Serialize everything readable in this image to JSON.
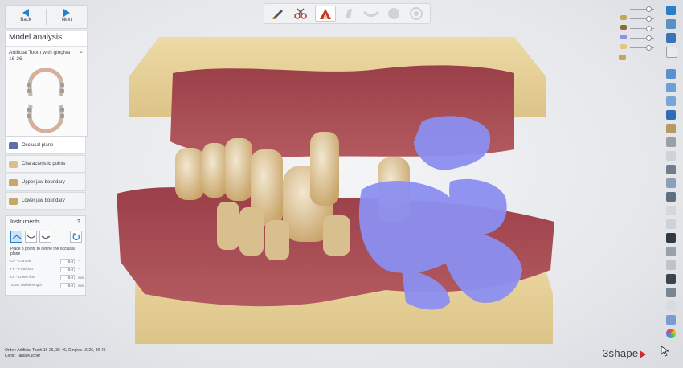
{
  "nav": {
    "back_label": "Back",
    "next_label": "Next"
  },
  "model": {
    "title": "Model analysis",
    "tooth_type": "Artificial Tooth with gingiva",
    "tooth_range": "16-26"
  },
  "steps": [
    {
      "label": "Occlusal plane",
      "active": true
    },
    {
      "label": "Characteristic points",
      "active": false
    },
    {
      "label": "Upper jaw boundary",
      "active": false
    },
    {
      "label": "Lower jaw boundary",
      "active": false
    }
  ],
  "instruments": {
    "title": "Instruments",
    "help": "?",
    "hint": "Place 3 points to define the occlusal plane",
    "params": [
      {
        "label": "CP - Camper",
        "value": "0.0",
        "unit": "°"
      },
      {
        "label": "FP - Frankfort",
        "value": "0.0",
        "unit": "°"
      },
      {
        "label": "LP - Lower line",
        "value": "0.0",
        "unit": "mm"
      },
      {
        "label": "Tooth visible length",
        "value": "0.0",
        "unit": "mm"
      }
    ]
  },
  "footer": {
    "order_label": "Order:",
    "order_value": "Artificial Tooth 16-26, 36-46, Gingiva 16-26, 36-46",
    "client_label": "Clinic:",
    "client_value": "Tania Kucher"
  },
  "brand": {
    "logo": "3shape"
  },
  "colors": {
    "accent": "#2a7fc9",
    "tooth": "#e7d29c",
    "gingiva": "#a64a52",
    "scan": "#8c8ff0",
    "logo_triangle": "#d0292f"
  }
}
